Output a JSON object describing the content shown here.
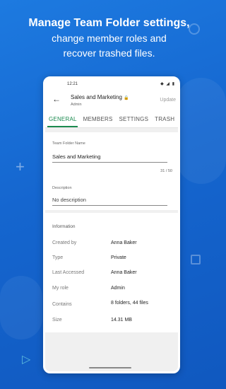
{
  "headline": {
    "line1": "Manage Team Folder settings,",
    "line2": "change member roles and",
    "line3": "recover trashed files."
  },
  "status_bar": {
    "time": "12:21",
    "icons": "◆ ◢ ▮"
  },
  "app_bar": {
    "back_icon": "←",
    "title": "Sales and Marketing",
    "lock_icon": "🔒",
    "subtitle": "Admin",
    "update_label": "Update"
  },
  "tabs": [
    {
      "label": "GENERAL",
      "active": true
    },
    {
      "label": "MEMBERS",
      "active": false
    },
    {
      "label": "SETTINGS",
      "active": false
    },
    {
      "label": "TRASH",
      "active": false
    }
  ],
  "general": {
    "name_label": "Team Folder Name",
    "name_value": "Sales and Marketing",
    "name_counter": "31 / 50",
    "description_label": "Description",
    "description_value": "No description"
  },
  "information": {
    "title": "Information",
    "rows": [
      {
        "key": "Created by",
        "value": "Anna Baker"
      },
      {
        "key": "Type",
        "value": "Private"
      },
      {
        "key": "Last Accessed",
        "value": "Anna Baker"
      },
      {
        "key": "My role",
        "value": "Admin"
      },
      {
        "key": "Contains",
        "value": "8 folders, 44 files"
      },
      {
        "key": "Size",
        "value": "14.31 MB"
      }
    ]
  },
  "colors": {
    "background": "#1566cf",
    "accent": "#1b8a4f"
  }
}
